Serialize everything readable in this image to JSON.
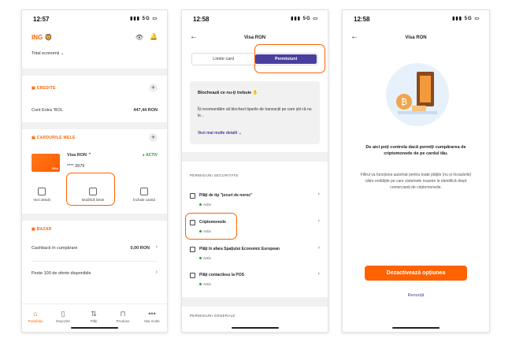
{
  "phone1": {
    "time": "12:57",
    "signal": "5G",
    "brand": "ING",
    "total": "Total economii",
    "credits_title": "CREDITE",
    "account_name": "Cont Extra 'ROL",
    "account_amount": "447,44 RON",
    "cards_title": "CARDURILE MELE",
    "card_name": "Visa RON",
    "card_number": "**** 3979",
    "card_status": "ACTIV",
    "card_label": "VISA",
    "actions": [
      "Vezi detalii",
      "Modifică limite",
      "Închide cardul"
    ],
    "bazar_title": "BAZAR",
    "cashback_label": "Cashback în cumpărare",
    "cashback_value": "0,00 RON",
    "offers_label": "Peste 100 de oferte disponibile",
    "tabs": [
      "Portofoliu",
      "Depozite",
      "Plăți",
      "Produse",
      "Mai multe"
    ]
  },
  "phone2": {
    "time": "12:58",
    "signal": "5G",
    "title": "Visa RON",
    "seg_left": "Limite card",
    "seg_right": "Permisiuni",
    "info_title": "Blochează ce nu-ți trebuie ✋",
    "info_text": "Îți recomandăm să blochezi tiparile de tranzacții pe care știi că nu le...",
    "info_link": "Vezi mai multe detalii",
    "security_header": "PERMISIUNI SECURITATE",
    "permissions": [
      {
        "label": "Plăți de tip \"jocuri de noroc\"",
        "status": "Activ"
      },
      {
        "label": "Criptomonede",
        "status": "Activ"
      },
      {
        "label": "Plăți în afara Spațiului Economic European",
        "status": "Activ"
      },
      {
        "label": "Plăți contactless la POS",
        "status": "Activ"
      }
    ],
    "general_header": "PERMISIUNI GENERALE"
  },
  "phone3": {
    "time": "12:58",
    "signal": "5G",
    "title": "Visa RON",
    "heading": "De aici poți controla dacă permiți cumpărarea de criptomonede de pe cardul tău.",
    "body": "Filtrul va funcționa automat pentru toate plățile (nu și încasările) către entitățile pe care sistemele noastre le identifică drept comercianți de criptomonede.",
    "primary_button": "Dezactivează opțiunea",
    "secondary_link": "Renunță"
  },
  "colors": {
    "accent": "#ff6200",
    "active": "#2a9d3a",
    "segment": "#4a3f9e"
  }
}
